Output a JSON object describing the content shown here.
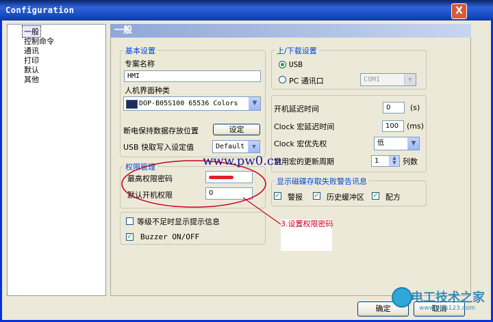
{
  "window": {
    "title": "Configuration",
    "close_label": "X"
  },
  "tree": {
    "items": [
      "一般",
      "控制命令",
      "通讯",
      "打印",
      "默认",
      "其他"
    ]
  },
  "panel": {
    "header": "一般"
  },
  "basic": {
    "title": "基本设置",
    "project_name_label": "专案名称",
    "project_name_value": "HMI",
    "hmi_type_label": "人机界面种类",
    "hmi_type_value": "DOP-B05S100 65536 Colors",
    "retain_label": "断电保持数据存放位置",
    "retain_button": "设定",
    "usb_label": "USB 快取写入设定值",
    "usb_value": "Default"
  },
  "upload": {
    "title": "上/下载设置",
    "usb_label": "USB",
    "pc_label": "PC 通讯口",
    "com_value": "COM1"
  },
  "timing": {
    "boot_delay_label": "开机延迟时间",
    "boot_delay_value": "0",
    "boot_delay_unit": "(s)",
    "clock_delay_label": "Clock 宏延迟时间",
    "clock_delay_value": "100",
    "clock_delay_unit": "(ms)",
    "clock_priority_label": "Clock 宏优先权",
    "clock_priority_value": "低",
    "cycle_label": "常用宏的更新周期",
    "cycle_value": "1",
    "cycle_unit": "列数"
  },
  "permission": {
    "title": "权限管理",
    "max_pwd_label": "最高权限密码",
    "default_level_label": "默认开机权限",
    "default_level_value": "0"
  },
  "options": {
    "level_warning_label": "等级不足时显示提示信息",
    "buzzer_label": "Buzzer ON/OFF"
  },
  "disk": {
    "title": "显示磁碟存取失败警告讯息",
    "alarm_label": "警报",
    "history_label": "历史缓冲区",
    "recipe_label": "配方"
  },
  "annotation": {
    "text": "3.设置权限密码",
    "watermark": "www.pw0.cn",
    "logo_text": "电工技术之家",
    "logo_url": "www.dgjs123.com"
  },
  "footer": {
    "ok_label": "确定",
    "cancel_label": "取消"
  },
  "colors": {
    "title_blue": "#0831d9",
    "annotation_red": "#c8001e",
    "watermark_blue": "#1a1aa0"
  }
}
